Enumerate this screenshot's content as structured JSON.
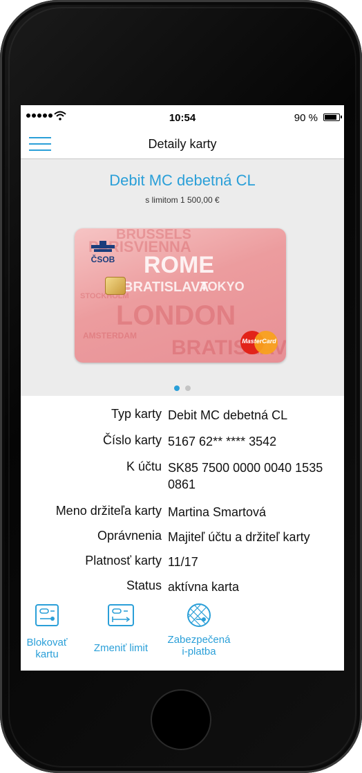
{
  "status_bar": {
    "time": "10:54",
    "battery_text": "90 %",
    "battery_level": 0.9,
    "signal_icon": "signal-dots-icon",
    "wifi_icon": "wifi-icon"
  },
  "nav": {
    "title": "Detaily karty",
    "menu_icon": "hamburger-menu-icon"
  },
  "card": {
    "name": "Debit MC debetná CL",
    "limit": "s limitom 1 500,00 €",
    "bank_name": "ČSOB",
    "network": "MasterCard",
    "background_words": [
      "PARISVIENNA",
      "BRUSSELS",
      "ROME",
      "BRATISLAVA",
      "TOKYO",
      "LONDON",
      "STOCKHOLM",
      "AMSTERDAM",
      "BRATISLAVA"
    ],
    "pager": {
      "count": 2,
      "active_index": 0
    }
  },
  "details": [
    {
      "label": "Typ karty",
      "value": "Debit MC debetná CL"
    },
    {
      "label": "Číslo karty",
      "value": "5167 62** **** 3542"
    },
    {
      "label": "K účtu",
      "value": "SK85 7500 0000 0040 1535 0861"
    },
    {
      "label": "Meno držiteľa karty",
      "value": "Martina Smartová"
    },
    {
      "label": "Oprávnenia",
      "value": "Majiteľ účtu a držiteľ karty"
    },
    {
      "label": "Platnosť karty",
      "value": "11/17"
    },
    {
      "label": "Status",
      "value": "aktívna karta"
    }
  ],
  "actions": [
    {
      "label_line1": "Blokovať",
      "label_line2": "kartu",
      "icon": "block-card-icon"
    },
    {
      "label_line1": "Zmeniť limit",
      "label_line2": "",
      "icon": "change-limit-icon"
    },
    {
      "label_line1": "Zabezpečená",
      "label_line2": "i-platba",
      "icon": "secure-payment-icon"
    }
  ],
  "colors": {
    "accent": "#2a9fd8",
    "card_area_bg": "#ececec",
    "pager_inactive": "#c4c4c4"
  }
}
